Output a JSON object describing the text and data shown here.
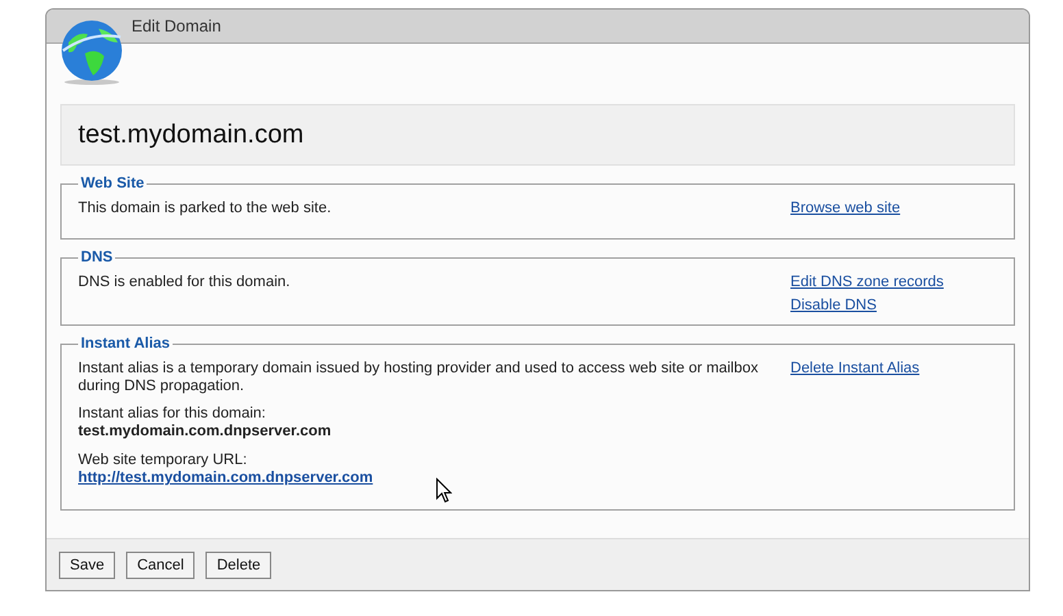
{
  "window": {
    "title": "Edit Domain"
  },
  "domain": "test.mydomain.com",
  "sections": [
    {
      "legend": "Web Site",
      "items": [
        {
          "kind": "text",
          "text": "This domain is parked to the web site."
        }
      ],
      "links": [
        "Browse web site"
      ]
    },
    {
      "legend": "DNS",
      "items": [
        {
          "kind": "text",
          "text": "DNS is enabled for this domain."
        }
      ],
      "links": [
        "Edit DNS zone records",
        "Disable DNS"
      ]
    },
    {
      "legend": "Instant Alias",
      "items": [
        {
          "kind": "text",
          "text": "Instant alias is a temporary domain issued by hosting provider and used to access web site or mailbox during DNS propagation."
        },
        {
          "kind": "value",
          "label": "Instant alias for this domain:",
          "value": "test.mydomain.com.dnpserver.com"
        },
        {
          "kind": "link",
          "label": "Web site temporary URL:",
          "value": "http://test.mydomain.com.dnpserver.com"
        }
      ],
      "links": [
        "Delete Instant Alias"
      ]
    }
  ],
  "buttons": [
    "Save",
    "Cancel",
    "Delete"
  ]
}
